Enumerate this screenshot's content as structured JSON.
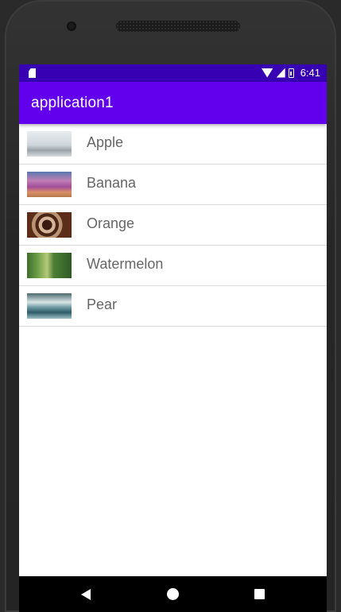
{
  "status_bar": {
    "time": "6:41"
  },
  "app_bar": {
    "title": "application1"
  },
  "list": {
    "items": [
      {
        "label": "Apple",
        "thumbnail": "misty-city-photo"
      },
      {
        "label": "Banana",
        "thumbnail": "flower-field-sunset-photo"
      },
      {
        "label": "Orange",
        "thumbnail": "spiral-staircase-photo"
      },
      {
        "label": "Watermelon",
        "thumbnail": "forest-path-photo"
      },
      {
        "label": "Pear",
        "thumbnail": "waterfall-photo"
      }
    ]
  },
  "colors": {
    "status_bar": "#3700b3",
    "app_bar": "#6200ee",
    "label_text": "#666666",
    "divider": "#dcdcdc"
  },
  "nav_bar": {
    "icons": [
      "back-icon",
      "home-icon",
      "recent-apps-icon"
    ]
  }
}
